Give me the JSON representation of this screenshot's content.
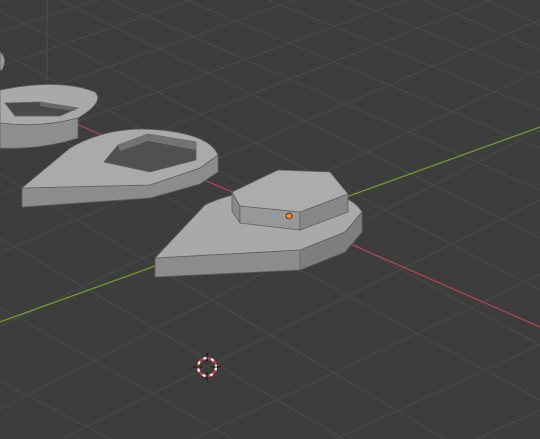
{
  "viewport": {
    "background_color": "#3d3d3d",
    "grid_line_color": "#4a4a4a",
    "x_axis_color": "#b0414a",
    "y_axis_color": "#6e9a2c",
    "object_face_top": "#a7a7a7",
    "object_face_side": "#8e8e8e",
    "object_face_dark": "#7b7b7b",
    "object_outline": "#5f5f5f",
    "origin_dot_color": "#ff8a00"
  },
  "objects": [
    {
      "name": "partial-ring-object",
      "icon": "mesh-object"
    },
    {
      "name": "teardrop-with-hole-object",
      "icon": "mesh-object"
    },
    {
      "name": "teardrop-with-hexagon-object",
      "icon": "mesh-object",
      "selected_origin": true
    }
  ],
  "cursor": {
    "icon": "3d-cursor-icon"
  }
}
